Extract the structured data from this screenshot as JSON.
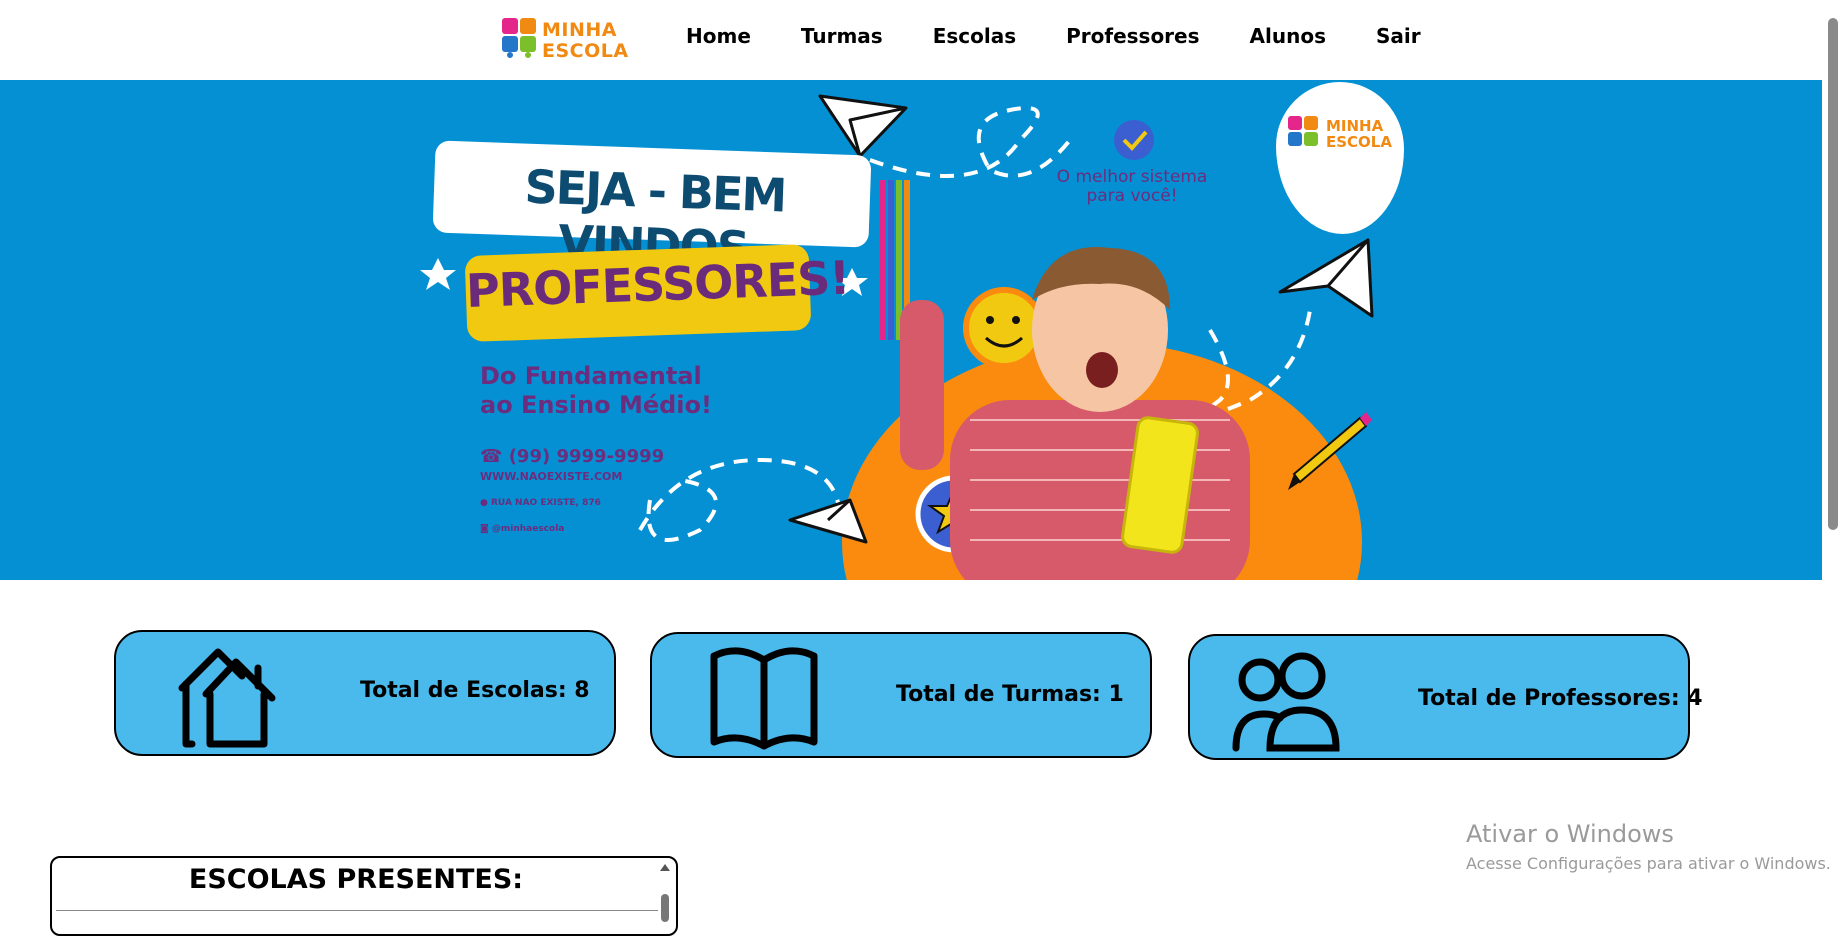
{
  "brand": {
    "name_line1": "MINHA",
    "name_line2": "ESCOLA"
  },
  "nav": {
    "items": [
      {
        "label": "Home"
      },
      {
        "label": "Turmas"
      },
      {
        "label": "Escolas"
      },
      {
        "label": "Professores"
      },
      {
        "label": "Alunos"
      },
      {
        "label": "Sair"
      }
    ]
  },
  "hero": {
    "welcome": "SEJA - BEM VINDOS",
    "audience": "PROFESSORES!",
    "tagline_line1": "Do Fundamental",
    "tagline_line2": "ao Ensino Médio!",
    "phone": "(99) 9999-9999",
    "website": "WWW.NAOEXISTE.COM",
    "address": "RUA NAO EXISTE, 876",
    "instagram": "@minhaescola",
    "motto_line1": "O melhor sistema",
    "motto_line2": "para você!",
    "logo_line1": "MINHA",
    "logo_line2": "ESCOLA"
  },
  "stats": {
    "escolas": "Total de Escolas: 8",
    "turmas": "Total de Turmas: 1",
    "professores": "Total de Professores: 4"
  },
  "schools_panel": {
    "title": "ESCOLAS PRESENTES:"
  },
  "windows_watermark": {
    "line1": "Ativar o Windows",
    "line2": "Acesse Configurações para ativar o Windows."
  },
  "colors": {
    "hero_bg": "#0490d2",
    "card_bg": "#4ab9ec",
    "accent_orange": "#fb8b0f",
    "accent_yellow": "#f2c911",
    "purple": "#6d2d7f"
  }
}
